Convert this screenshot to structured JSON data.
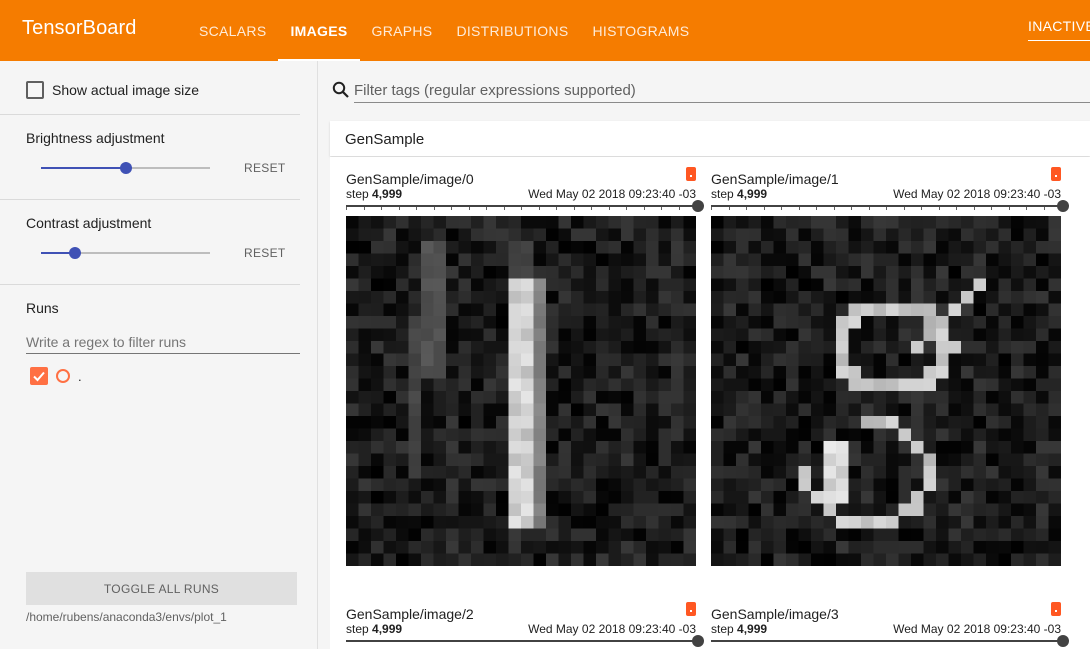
{
  "app": {
    "title": "TensorBoard"
  },
  "tabs": [
    {
      "label": "SCALARS",
      "active": false
    },
    {
      "label": "IMAGES",
      "active": true
    },
    {
      "label": "GRAPHS",
      "active": false
    },
    {
      "label": "DISTRIBUTIONS",
      "active": false
    },
    {
      "label": "HISTOGRAMS",
      "active": false
    }
  ],
  "topbar": {
    "inactive_label": "INACTIVE"
  },
  "sidebar": {
    "show_actual_size": {
      "label": "Show actual image size",
      "checked": false
    },
    "brightness": {
      "title": "Brightness adjustment",
      "reset_label": "RESET",
      "value": 0.5
    },
    "contrast": {
      "title": "Contrast adjustment",
      "reset_label": "RESET",
      "value": 0.2
    },
    "runs": {
      "title": "Runs",
      "filter_placeholder": "Write a regex to filter runs",
      "items": [
        {
          "name": ".",
          "checked": true
        }
      ]
    },
    "toggle_all_label": "TOGGLE ALL RUNS",
    "logdir": "/home/rubens/anaconda3/envs/plot_1"
  },
  "main": {
    "filter_placeholder": "Filter tags (regular expressions supported)",
    "category": "GenSample",
    "cards": [
      {
        "tag": "GenSample/image/0",
        "step_label": "step",
        "step": "4,999",
        "time": "Wed May 02 2018 09:23:40 -03"
      },
      {
        "tag": "GenSample/image/1",
        "step_label": "step",
        "step": "4,999",
        "time": "Wed May 02 2018 09:23:40 -03"
      },
      {
        "tag": "GenSample/image/2",
        "step_label": "step",
        "step": "4,999",
        "time": "Wed May 02 2018 09:23:40 -03"
      },
      {
        "tag": "GenSample/image/3",
        "step_label": "step",
        "step": "4,999",
        "time": "Wed May 02 2018 09:23:40 -03"
      }
    ]
  },
  "colors": {
    "accent": "#f57c00",
    "slider": "#3f51b5",
    "run": "#ff7043"
  },
  "icons": {
    "search": "search-icon",
    "run_check": "checkmark-icon",
    "run_color": "circle-icon"
  }
}
